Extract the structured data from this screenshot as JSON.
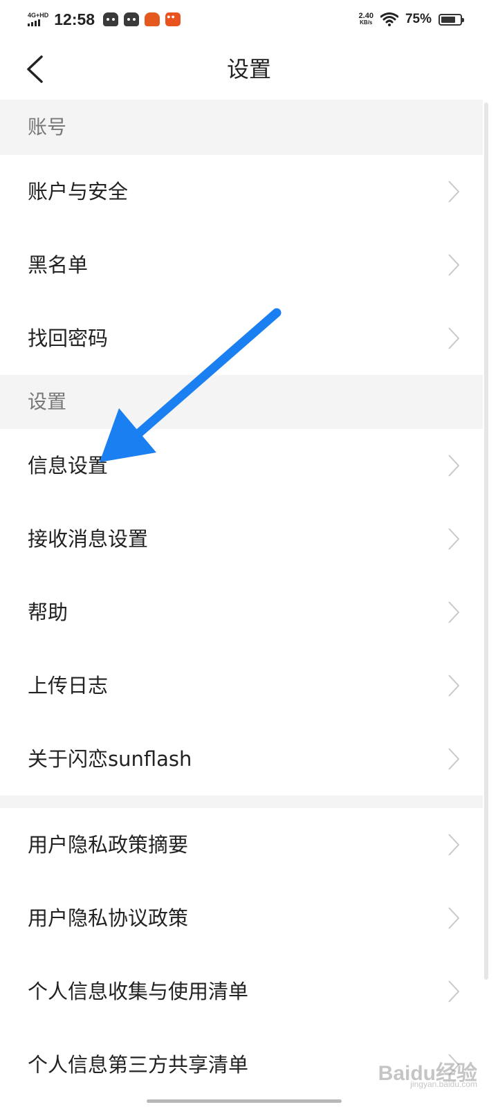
{
  "status_bar": {
    "network": "4G+HD",
    "time": "12:58",
    "speed_value": "2.40",
    "speed_unit": "KB/s",
    "battery_percent": "75%",
    "battery_level": 0.75
  },
  "header": {
    "title": "设置",
    "back_icon": "chevron-left-icon"
  },
  "sections": {
    "account_header": "账号",
    "settings_header": "设置"
  },
  "rows": {
    "account_security": "账户与安全",
    "blacklist": "黑名单",
    "recover_password": "找回密码",
    "info_settings": "信息设置",
    "receive_message_settings": "接收消息设置",
    "help": "帮助",
    "upload_log": "上传日志",
    "about": "关于闪恋sunflash",
    "privacy_summary": "用户隐私政策摘要",
    "privacy_agreement": "用户隐私协议政策",
    "personal_info_list": "个人信息收集与使用清单",
    "third_party_list": "个人信息第三方共享清单"
  },
  "annotation": {
    "arrow_color": "#1a7ff0"
  },
  "watermark": {
    "text": "Baidu经验",
    "sub": "jingyan.baidu.com"
  },
  "colors": {
    "section_bg": "#f4f4f4",
    "text": "#222222",
    "section_text": "#777777"
  }
}
